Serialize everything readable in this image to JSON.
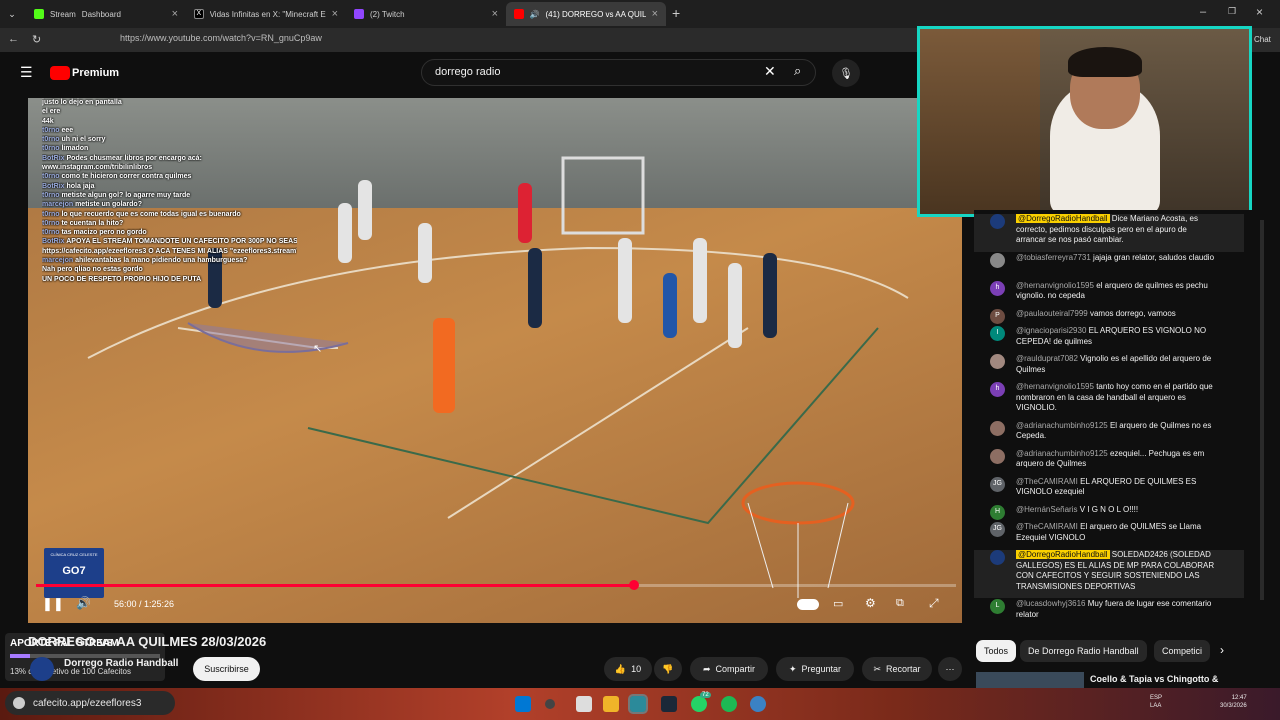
{
  "browser": {
    "tabs": [
      {
        "label": "Stream",
        "sub_label": "Dashboard",
        "active": false
      },
      {
        "label": "Vidas Infinitas en X: \"Minecraft Ex",
        "active": false
      },
      {
        "label": "(2) Twitch",
        "active": false
      },
      {
        "label": "(41) DORREGO vs AA QUILME",
        "active": true
      }
    ],
    "url": "https://www.youtube.com/watch?v=RN_gnuCp9aw",
    "chat_side_label": "Chat"
  },
  "youtube": {
    "logo_text": "Premium",
    "search_value": "dorrego radio",
    "video": {
      "time_current": "56:00",
      "time_total": "1:25:26",
      "time_text": "56:00 / 1:25:26",
      "progress": 0.65,
      "sponsor_label": "GO7",
      "sponsor_top": "CLÍNICA CRUZ CELESTE"
    },
    "title": "DORREGO vs AA QUILMES 28/03/2026",
    "channel_name": "Dorrego Radio Handball",
    "subscribe_label": "Suscribirse",
    "actions": {
      "likes": "10",
      "share": "Compartir",
      "ask": "Preguntar",
      "clip": "Recortar"
    },
    "chips": [
      "Todos",
      "De Dorrego Radio Handball",
      "Competici"
    ],
    "next_video": "Coello & Tapia vs Chingotto &"
  },
  "overlay_chat": [
    {
      "user": "",
      "text": "justo lo dejo en pantalla"
    },
    {
      "user": "",
      "text": "el ere"
    },
    {
      "user": "",
      "text": "44k"
    },
    {
      "user": "t0rno",
      "text": "eee"
    },
    {
      "user": "t0rno",
      "text": "uh ni el sorry"
    },
    {
      "user": "t0rno",
      "text": "limadon"
    },
    {
      "user": "BotRix",
      "text": "Podes chusmear libros por encargo acá:"
    },
    {
      "user": "",
      "text": "www.instagram.com/tribilinlibros"
    },
    {
      "user": "t0rno",
      "text": "como te hicieron correr contra quilmes"
    },
    {
      "user": "BotRix",
      "text": "hola jaja"
    },
    {
      "user": "t0rno",
      "text": "metiste algun gol? lo agarre muy tarde"
    },
    {
      "user": "marcejon",
      "text": "metiste un golardo?"
    },
    {
      "user": "t0rno",
      "text": "lo que recuerdo que es come todas igual es buenardo"
    },
    {
      "user": "t0rno",
      "text": "te cuentan la hito?"
    },
    {
      "user": "t0rno",
      "text": "tas macizo pero no gordo"
    },
    {
      "user": "BotRix",
      "text": "APOYA EL STREAM TOMANDOTE UN CAFECITO POR 300P NO SEAS RATON"
    },
    {
      "user": "",
      "text": "https://cafecito.app/ezeeflores3 O ACA TENES MI ALIAS \"ezeeflores3.stream\""
    },
    {
      "user": "marcejon",
      "text": "ahilevantabas la mano pidiendo una hamburguesa?"
    },
    {
      "user": "",
      "text": "Nah pero qliao no estas gordo"
    },
    {
      "user": "",
      "text": "UN POCO DE RESPETO PROPIO HIJO DE PUTA"
    }
  ],
  "donation": {
    "label": "APORTE PAL STREAM",
    "goal_text": "13% del objetivo de 100 Cafecitos",
    "progress": 0.13
  },
  "live_chat": [
    {
      "author": "@DorregoRadioHandball",
      "text": "Dice Mariano Acosta, es correcto, pedimos disculpas pero en el apuro de arrancar se nos pasó cambiar.",
      "highlight": true,
      "avatar": "",
      "color": "#1c3b7a"
    },
    {
      "author": "@tobiasferreyra7731",
      "text": "jajaja gran relator, saludos claudio",
      "highlight": false,
      "avatar": "",
      "color": "#888"
    },
    {
      "author": "@hernanvignolio1595",
      "text": "el arquero de quilmes es pechu vignolio. no cepeda",
      "highlight": false,
      "avatar": "h",
      "color": "#7b3fb5"
    },
    {
      "author": "@paulaouteiral7999",
      "text": "vamos dorrego, vamoos",
      "highlight": false,
      "avatar": "P",
      "color": "#6d4c41"
    },
    {
      "author": "@ignacioparisi2930",
      "text": "EL ARQUERO ES VIGNOLO NO CEPEDA! de quilmes",
      "highlight": false,
      "avatar": "I",
      "color": "#00897b"
    },
    {
      "author": "@raulduprat7082",
      "text": "Vignolio es el apellido del arquero de Quilmes",
      "highlight": false,
      "avatar": "",
      "color": "#a1887f"
    },
    {
      "author": "@hernanvignolio1595",
      "text": "tanto hoy como en el partido que nombraron en la casa de handball el arquero es VIGNOLIO.",
      "highlight": false,
      "avatar": "h",
      "color": "#7b3fb5"
    },
    {
      "author": "@adrianachumbinho9125",
      "text": "El arquero de Quilmes no es Cepeda.",
      "highlight": false,
      "avatar": "",
      "color": "#8d6e63"
    },
    {
      "author": "@adrianachumbinho9125",
      "text": "ezequiel... Pechuga es em arquero de Quilmes",
      "highlight": false,
      "avatar": "",
      "color": "#8d6e63"
    },
    {
      "author": "@TheCAMIRAMI",
      "text": "EL ARQUERO DE QUILMES ES VIGNOLO ezequiel",
      "highlight": false,
      "avatar": "JG",
      "color": "#5f6368"
    },
    {
      "author": "@HernánSeñaris",
      "text": "V I G N O L O!!!!",
      "highlight": false,
      "avatar": "H",
      "color": "#2e7d32"
    },
    {
      "author": "@TheCAMIRAMI",
      "text": "El arquero de QUILMES se Llama Ezequiel VIGNOLO",
      "highlight": false,
      "avatar": "JG",
      "color": "#5f6368"
    },
    {
      "author": "@DorregoRadioHandball",
      "text": "SOLEDAD2426 (SOLEDAD GALLEGOS) ES EL ALIAS DE MP PARA COLABORAR CON CAFECITOS Y SEGUIR SOSTENIENDO LAS TRANSMISIONES DEPORTIVAS",
      "highlight": true,
      "avatar": "",
      "color": "#1c3b7a"
    },
    {
      "author": "@lucasdowhyj3616",
      "text": "Muy fuera de lugar ese comentario relator",
      "highlight": false,
      "avatar": "L",
      "color": "#2e7d32"
    }
  ],
  "taskbar": {
    "search_text": "cafecito.app/ezeeflores3",
    "whatsapp_badge": "72",
    "lang": "ESP",
    "lang2": "LAA",
    "clock_time": "12:47",
    "clock_date": "30/3/2026"
  }
}
